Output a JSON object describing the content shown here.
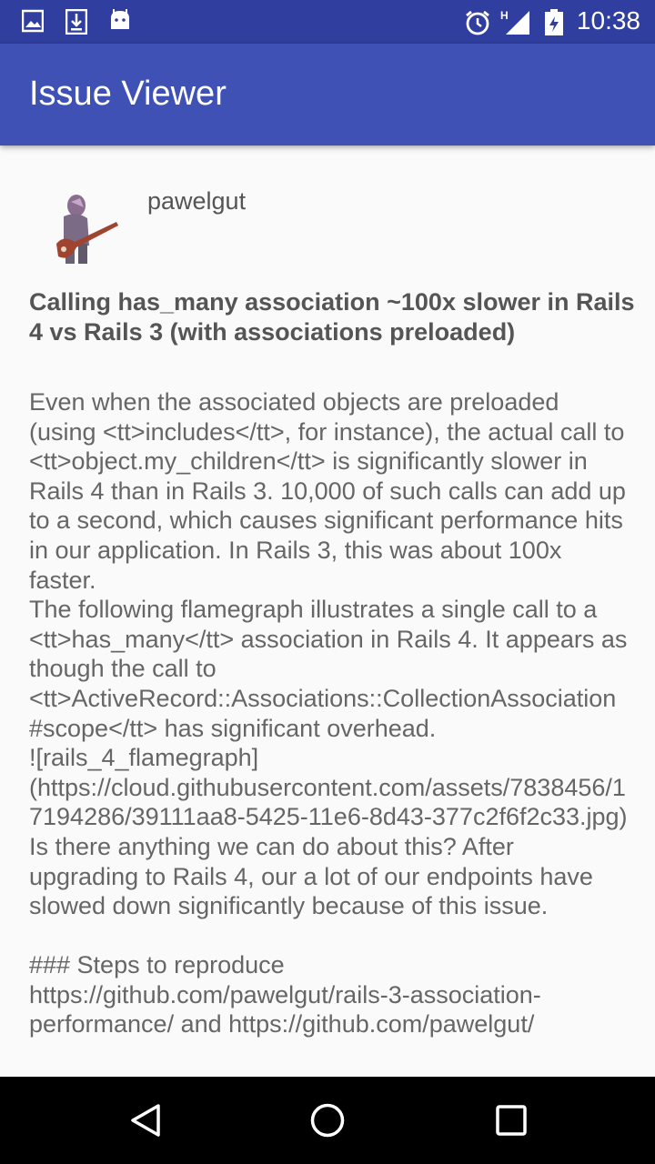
{
  "status_bar": {
    "time": "10:38",
    "icons": [
      "image-icon",
      "download-icon",
      "android-icon",
      "alarm-icon",
      "signal-h-icon",
      "battery-charging-icon"
    ]
  },
  "app_bar": {
    "title": "Issue Viewer"
  },
  "issue": {
    "author": "pawelgut",
    "title": "Calling has_many association ~100x slower in Rails 4 vs Rails 3 (with associations preloaded)",
    "body": "Even when the associated objects are preloaded (using <tt>includes</tt>, for instance), the actual call to <tt>object.my_children</tt> is significantly slower in Rails 4 than in Rails 3. 10,000 of such calls can add up to a second, which causes significant performance hits in our application. In Rails 3, this was about 100x faster.\nThe following flamegraph illustrates a single call to a <tt>has_many</tt> association in Rails 4. It appears as though the call to <tt>ActiveRecord::Associations::CollectionAssociation#scope</tt> has significant overhead.\n![rails_4_flamegraph](https://cloud.githubusercontent.com/assets/7838456/17194286/39111aa8-5425-11e6-8d43-377c2f6f2c33.jpg)\nIs there anything we can do about this? After upgrading to Rails 4, our a lot of our endpoints have slowed down significantly because of this issue.\n\n### Steps to reproduce\nhttps://github.com/pawelgut/rails-3-association-performance/ and https://github.com/pawelgut/"
  },
  "nav_bar": {
    "buttons": [
      "back",
      "home",
      "recents"
    ]
  }
}
